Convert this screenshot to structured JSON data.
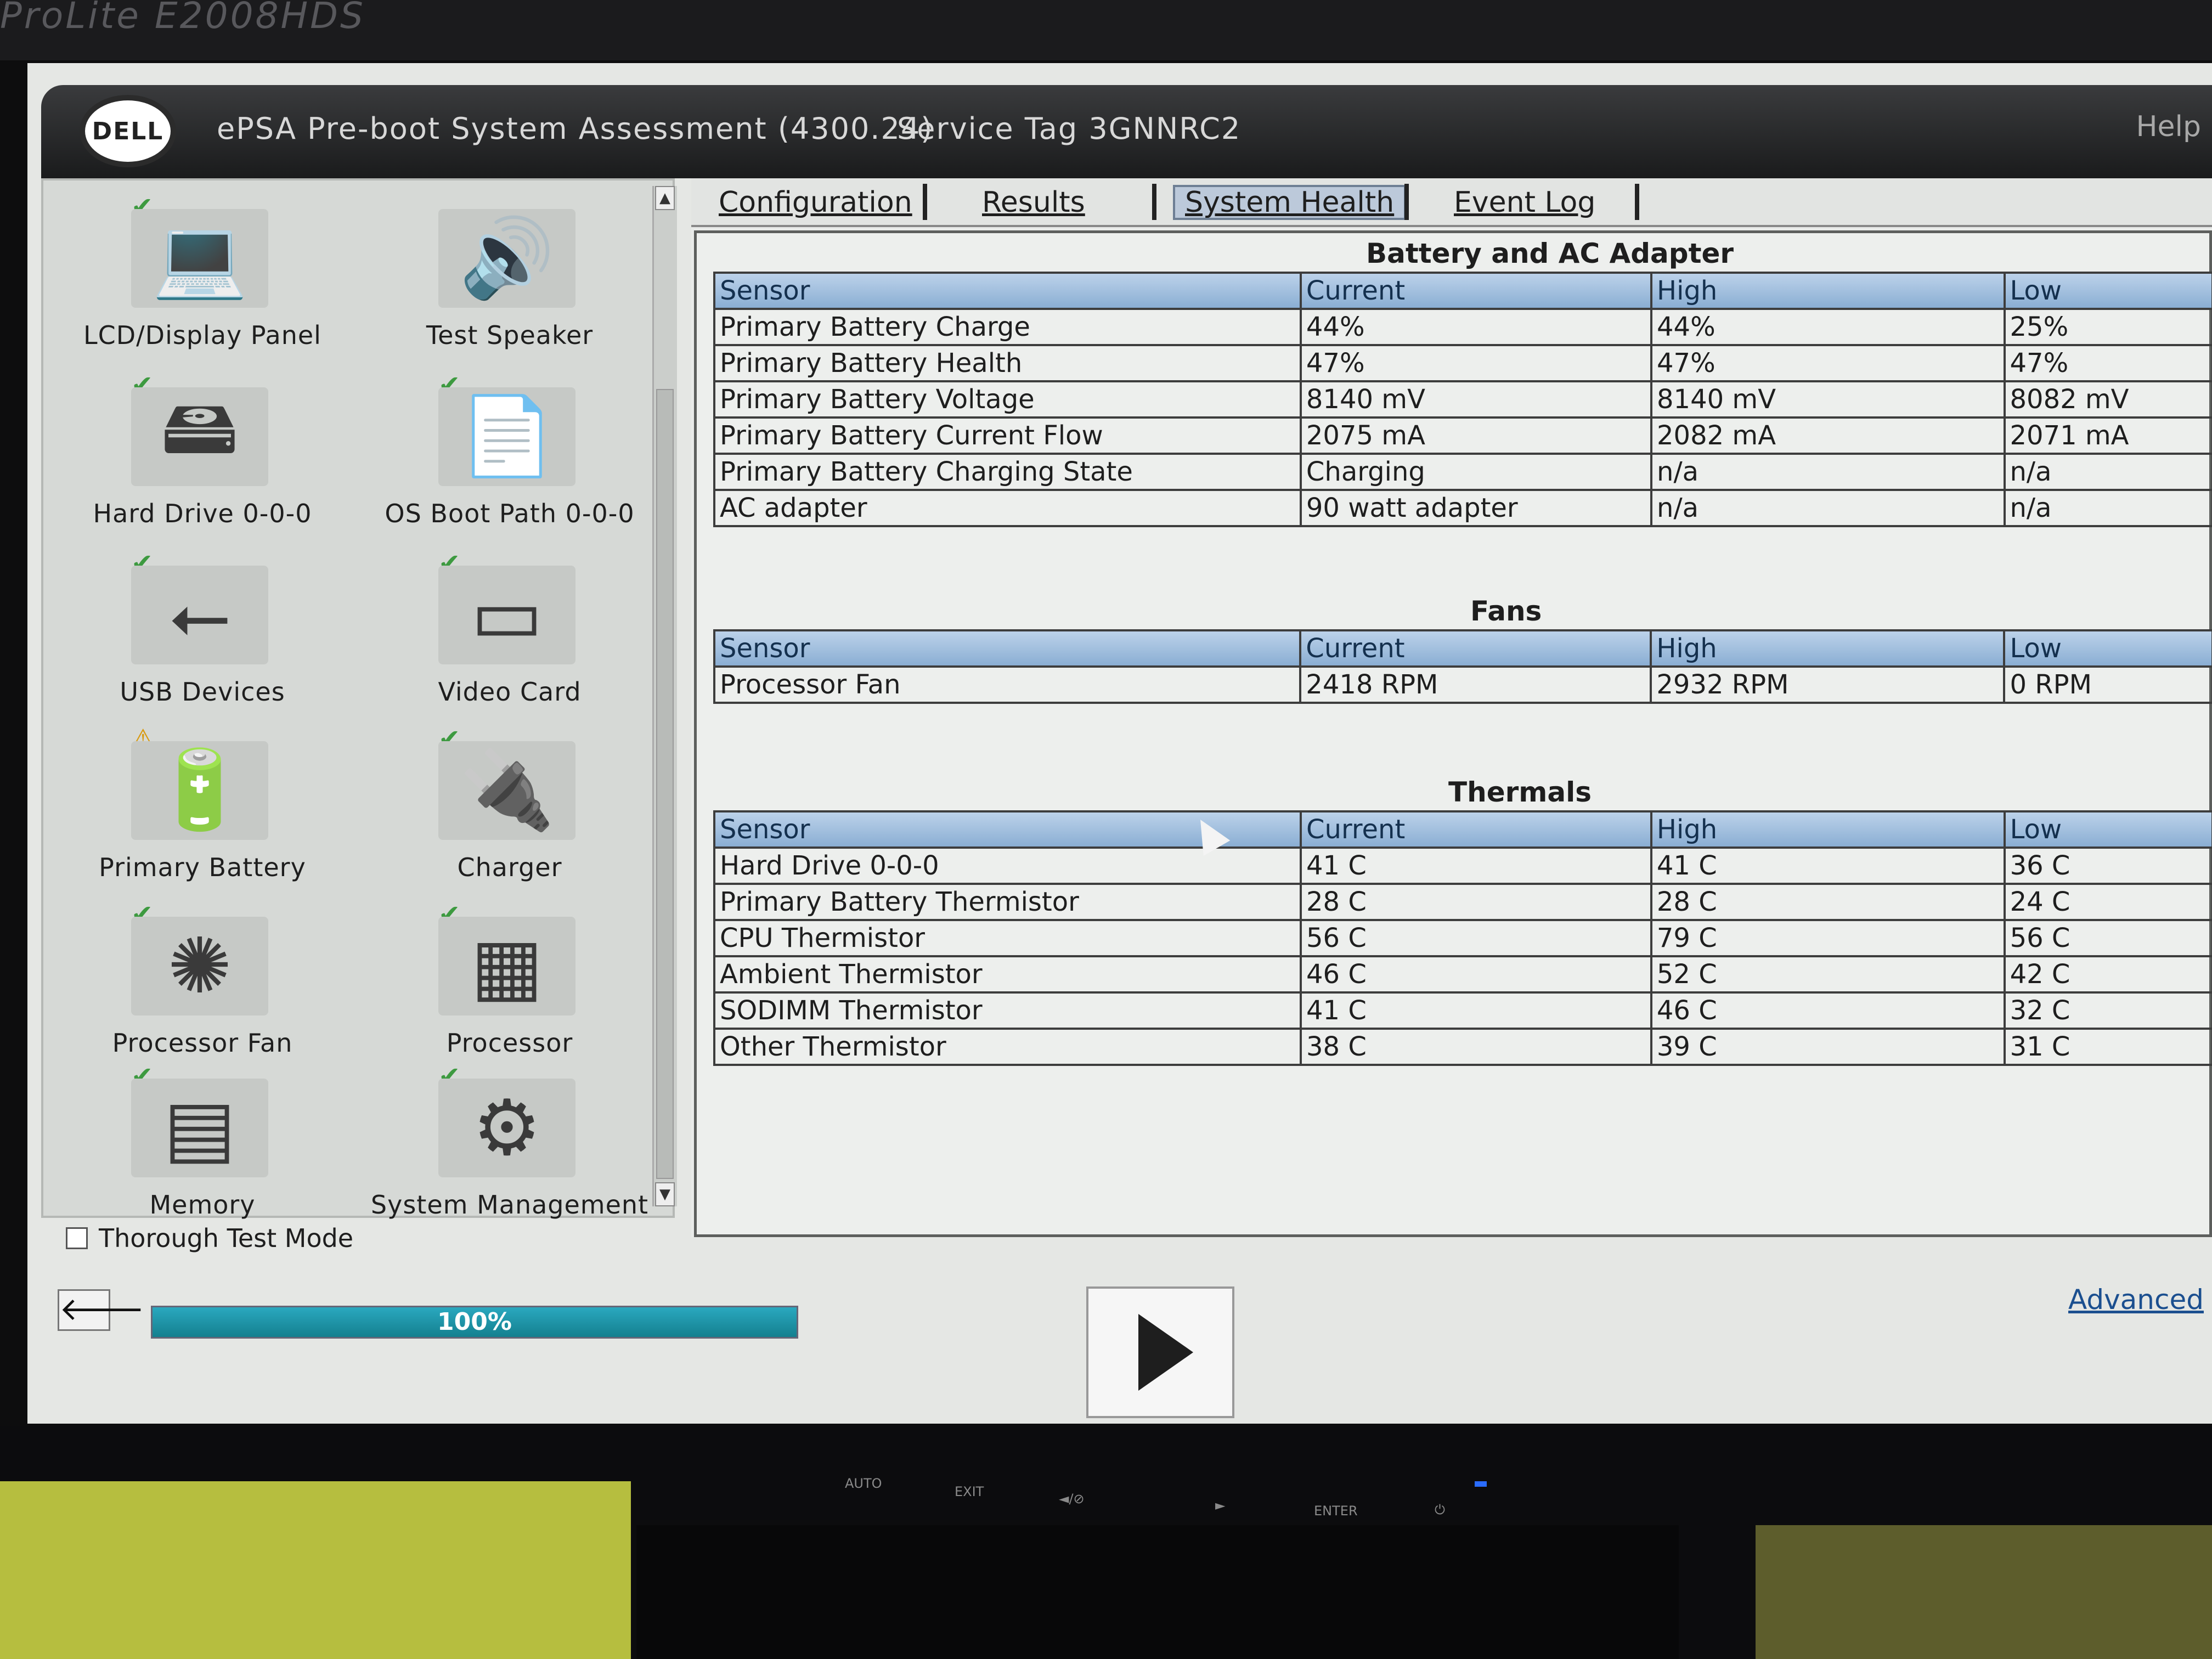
{
  "monitor": {
    "model": "ProLite E2008HDS"
  },
  "app": {
    "title": "ePSA Pre-boot System Assessment (4300.24)",
    "service_tag": "Service Tag 3GNNRC2",
    "help": "Help",
    "logo": "DELL"
  },
  "devices": [
    {
      "label": "LCD/Display Panel",
      "icon": "laptop-icon",
      "status": "ok"
    },
    {
      "label": "Test Speaker",
      "icon": "speaker-icon",
      "status": "none"
    },
    {
      "label": "Hard Drive 0-0-0",
      "icon": "hard-drive-icon",
      "status": "ok"
    },
    {
      "label": "OS Boot Path 0-0-0",
      "icon": "boot-path-icon",
      "status": "ok"
    },
    {
      "label": "USB Devices",
      "icon": "usb-icon",
      "status": "ok"
    },
    {
      "label": "Video Card",
      "icon": "video-card-icon",
      "status": "ok"
    },
    {
      "label": "Primary Battery",
      "icon": "battery-icon",
      "status": "warning"
    },
    {
      "label": "Charger",
      "icon": "charger-icon",
      "status": "ok"
    },
    {
      "label": "Processor Fan",
      "icon": "fan-icon",
      "status": "ok"
    },
    {
      "label": "Processor",
      "icon": "chip-icon",
      "status": "ok"
    },
    {
      "label": "Memory",
      "icon": "memory-icon",
      "status": "ok"
    },
    {
      "label": "System Management",
      "icon": "system-management-icon",
      "status": "ok"
    }
  ],
  "thorough_mode": {
    "label": "Thorough Test Mode",
    "checked": false
  },
  "progress": {
    "value": 100,
    "text": "100%"
  },
  "advanced_link": "Advanced",
  "tabs": [
    {
      "label": "Configuration",
      "active": false
    },
    {
      "label": "Results",
      "active": false
    },
    {
      "label": "System Health",
      "active": true
    },
    {
      "label": "Event Log",
      "active": false
    }
  ],
  "battery_section": {
    "title": "Battery and AC Adapter",
    "headers": [
      "Sensor",
      "Current",
      "High",
      "Low"
    ],
    "rows": [
      [
        "Primary Battery Charge",
        "44%",
        "44%",
        "25%"
      ],
      [
        "Primary Battery Health",
        "47%",
        "47%",
        "47%"
      ],
      [
        "Primary Battery Voltage",
        "8140 mV",
        "8140 mV",
        "8082 mV"
      ],
      [
        "Primary Battery Current Flow",
        "2075 mA",
        "2082 mA",
        "2071 mA"
      ],
      [
        "Primary Battery Charging State",
        "Charging",
        "n/a",
        "n/a"
      ],
      [
        "AC adapter",
        "90 watt adapter",
        "n/a",
        "n/a"
      ]
    ]
  },
  "fans_section": {
    "title": "Fans",
    "headers": [
      "Sensor",
      "Current",
      "High",
      "Low"
    ],
    "rows": [
      [
        "Processor Fan",
        "2418 RPM",
        "2932 RPM",
        "0 RPM"
      ]
    ]
  },
  "thermals_section": {
    "title": "Thermals",
    "headers": [
      "Sensor",
      "Current",
      "High",
      "Low"
    ],
    "rows": [
      [
        "Hard Drive 0-0-0",
        "41 C",
        "41 C",
        "36 C"
      ],
      [
        "Primary Battery Thermistor",
        "28 C",
        "28 C",
        "24 C"
      ],
      [
        "CPU Thermistor",
        "56 C",
        "79 C",
        "56 C"
      ],
      [
        "Ambient Thermistor",
        "46 C",
        "52 C",
        "42 C"
      ],
      [
        "SODIMM Thermistor",
        "41 C",
        "46 C",
        "32 C"
      ],
      [
        "Other Thermistor",
        "38 C",
        "39 C",
        "31 C"
      ]
    ]
  },
  "bezel_buttons": [
    "AUTO",
    "EXIT",
    "◄/⊘",
    "►",
    "ENTER",
    "⏻"
  ]
}
